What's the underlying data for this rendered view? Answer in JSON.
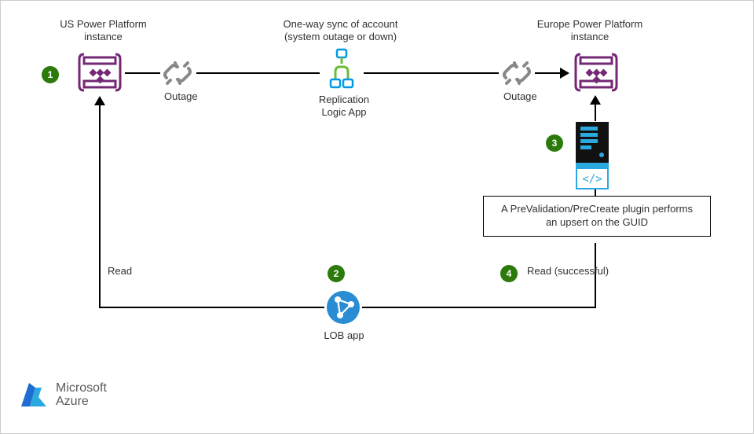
{
  "nodes": {
    "us_pp": {
      "title": "US Power Platform\ninstance"
    },
    "outage_left": {
      "label": "Outage"
    },
    "outage_right": {
      "label": "Outage"
    },
    "sync": {
      "title": "One-way sync of account\n(system outage or down)",
      "sub_name": "Replication",
      "sub_type": "Logic App"
    },
    "eu_pp": {
      "title": "Europe Power Platform\ninstance"
    },
    "plugin_note": {
      "text": "A PreValidation/PreCreate\nplugin performs an upsert\non the GUID"
    },
    "lob": {
      "label": "LOB app"
    },
    "read_left": {
      "label": "Read"
    },
    "read_right": {
      "label": "Read (successful)"
    }
  },
  "steps": {
    "s1": "1",
    "s2": "2",
    "s3": "3",
    "s4": "4"
  },
  "brand": {
    "line1": "Microsoft",
    "line2": "Azure"
  },
  "icons": {
    "powerplatform": "powerplatform-icon",
    "chainbreak": "chain-break-icon",
    "logicapp": "logic-app-icon",
    "server": "server-icon",
    "codefile": "code-file-icon",
    "network": "network-app-icon",
    "azure": "azure-icon"
  }
}
